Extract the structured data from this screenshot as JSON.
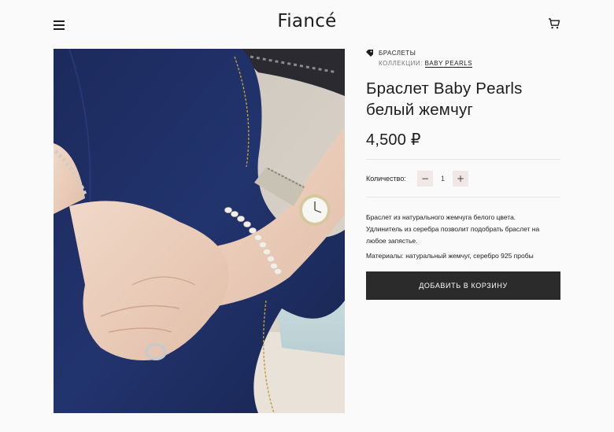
{
  "header": {
    "logo": "Fiancé",
    "menu_icon": "hamburger-menu-icon",
    "cart_icon": "cart-icon"
  },
  "product": {
    "category": "БРАСЛЕТЫ",
    "category_icon": "tag-icon",
    "collection_label": "КОЛЛЕКЦИИ:",
    "collection_link": "BABY PEARLS",
    "title_line1": "Браслет Baby Pearls",
    "title_line2": "белый жемчуг",
    "price": "4,500 ₽",
    "quantity_label": "Количество:",
    "quantity_value": "1",
    "minus_label": "−",
    "plus_label": "+",
    "description_line1": "Браслет из натурального жемчуга белого цвета.",
    "description_line2": "Удлинитель из серебра позволит подобрать браслет на",
    "description_line3": "любое запястье.",
    "materials": "Материалы: натуральный жемчуг, серебро 925 пробы",
    "add_to_cart": "ДОБАВИТЬ В КОРЗИНУ"
  },
  "colors": {
    "background": "#fafafa",
    "text": "#1d1d1d",
    "button_dark": "#2b2b2b",
    "qty_button": "#efe8e4"
  }
}
